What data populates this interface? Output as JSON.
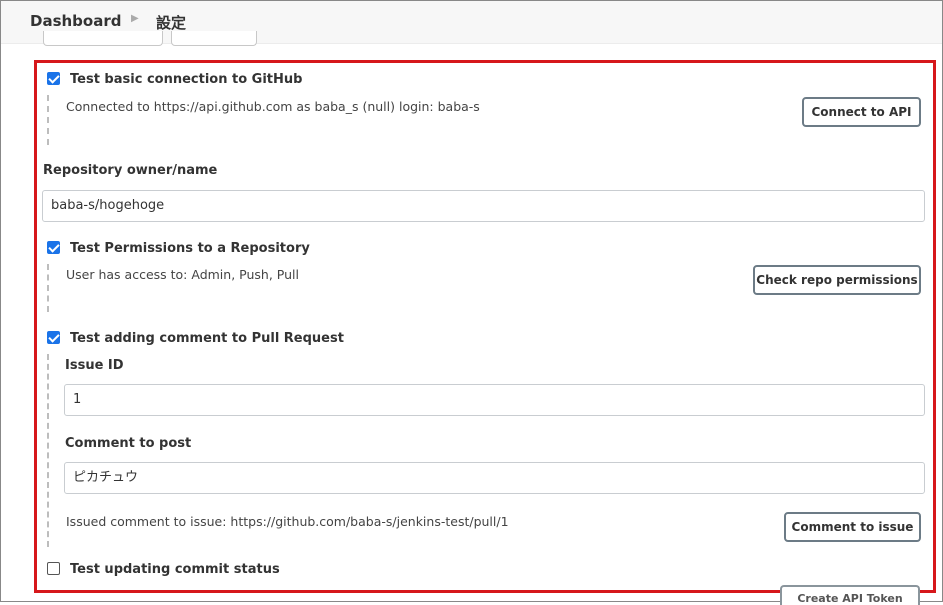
{
  "breadcrumb": {
    "home": "Dashboard",
    "current": "設定"
  },
  "sections": {
    "basic": {
      "checkbox_label": "Test basic connection to GitHub",
      "checked": true,
      "result": "Connected to https://api.github.com as baba_s (null) login: baba-s",
      "button": "Connect to API"
    },
    "repo": {
      "label": "Repository owner/name",
      "value": "baba-s/hogehoge"
    },
    "permissions": {
      "checkbox_label": "Test Permissions to a Repository",
      "checked": true,
      "result": "User has access to: Admin, Push, Pull",
      "button": "Check repo permissions"
    },
    "comment": {
      "checkbox_label": "Test adding comment to Pull Request",
      "checked": true,
      "issue_id_label": "Issue ID",
      "issue_id_value": "1",
      "comment_label": "Comment to post",
      "comment_value": "ピカチュウ",
      "result": "Issued comment to issue: https://github.com/baba-s/jenkins-test/pull/1",
      "button": "Comment to issue"
    },
    "commit_status": {
      "checkbox_label": "Test updating commit status",
      "checked": false
    },
    "api_token": {
      "button": "Create API Token"
    }
  },
  "colors": {
    "highlight": "#d6171b",
    "checkbox": "#1a73e8"
  }
}
